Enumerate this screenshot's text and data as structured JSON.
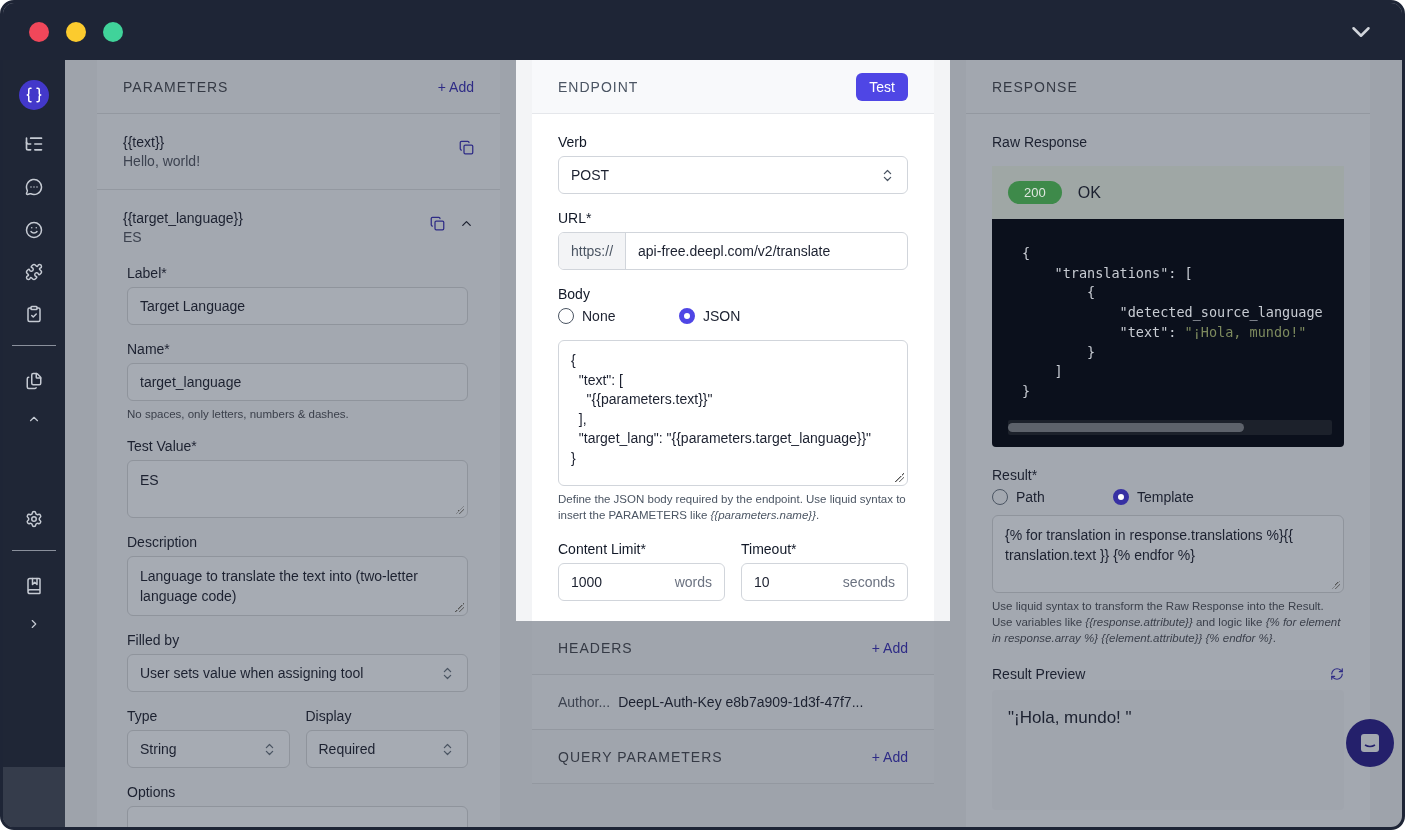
{
  "window": {
    "lights": [
      {
        "color": "#f0475a"
      },
      {
        "color": "#fccb2e"
      },
      {
        "color": "#40d39a"
      }
    ]
  },
  "parameters": {
    "title": "PARAMETERS",
    "add": "+ Add",
    "items": [
      {
        "name": "{{text}}",
        "value": "Hello, world!",
        "expanded": false
      },
      {
        "name": "{{target_language}}",
        "value": "ES",
        "expanded": true,
        "fields": [
          {
            "kind": "input",
            "label": "Label*",
            "value": "Target Language"
          },
          {
            "kind": "input",
            "label": "Name*",
            "value": "target_language",
            "hint": "No spaces, only letters, numbers & dashes."
          },
          {
            "kind": "textarea",
            "label": "Test Value*",
            "value": "ES"
          },
          {
            "kind": "textarea",
            "label": "Description",
            "value": "Language to translate the text into (two-letter language code)"
          },
          {
            "kind": "select",
            "label": "Filled by",
            "value": "User sets value when assigning tool"
          },
          {
            "kind": "pair",
            "fields": [
              {
                "kind": "select",
                "label": "Type",
                "value": "String"
              },
              {
                "kind": "select",
                "label": "Display",
                "value": "Required"
              }
            ]
          },
          {
            "kind": "input",
            "label": "Options"
          }
        ]
      }
    ]
  },
  "endpoint": {
    "title": "ENDPOINT",
    "test": "Test",
    "verb": {
      "label": "Verb",
      "value": "POST"
    },
    "url": {
      "label": "URL*",
      "prefix": "https://",
      "value": "api-free.deepl.com/v2/translate"
    },
    "body": {
      "label": "Body",
      "options": [
        {
          "label": "None",
          "selected": false
        },
        {
          "label": "JSON",
          "selected": true
        }
      ],
      "code": "{\n  \"text\": [\n    \"{{parameters.text}}\"\n  ],\n  \"target_lang\": \"{{parameters.target_language}}\"\n}",
      "hint": "Define the JSON body required by the endpoint. Use liquid syntax to insert the PARAMETERS like *{{parameters.name}}*."
    },
    "limits": [
      {
        "label": "Content Limit*",
        "value": "1000",
        "unit": "words"
      },
      {
        "label": "Timeout*",
        "value": "10",
        "unit": "seconds"
      }
    ]
  },
  "headers": {
    "title": "HEADERS",
    "add": "+ Add",
    "rows": [
      {
        "key": "Author...",
        "value": "DeepL-Auth-Key e8b7a909-1d3f-47f7..."
      }
    ]
  },
  "query": {
    "title": "QUERY PARAMETERS",
    "add": "+ Add"
  },
  "response": {
    "title": "RESPONSE",
    "raw_label": "Raw Response",
    "status": {
      "code": "200",
      "text": "OK"
    },
    "lines": [
      {
        "code": "{"
      },
      {
        "code": "    \"translations\": ["
      },
      {
        "code": "        {"
      },
      {
        "code": "            \"detected_source_language"
      },
      {
        "code": "            \"text\": ",
        "string": "\"¡Hola, mundo!\""
      },
      {
        "code": "        }"
      },
      {
        "code": "    ]"
      },
      {
        "code": "}"
      }
    ],
    "result": {
      "label": "Result*",
      "options": [
        {
          "label": "Path",
          "selected": false
        },
        {
          "label": "Template",
          "selected": true
        }
      ],
      "value": "{% for translation in response.translations %}{{ translation.text }} {% endfor %}",
      "hint": "Use liquid syntax to transform the Raw Response into the Result. Use variables like *{{response.attribute}}* and logic like *{% for element in response.array %} {{element.attribute}} {% endfor %}*."
    },
    "preview": {
      "label": "Result Preview",
      "value": "\"¡Hola, mundo! \""
    }
  }
}
